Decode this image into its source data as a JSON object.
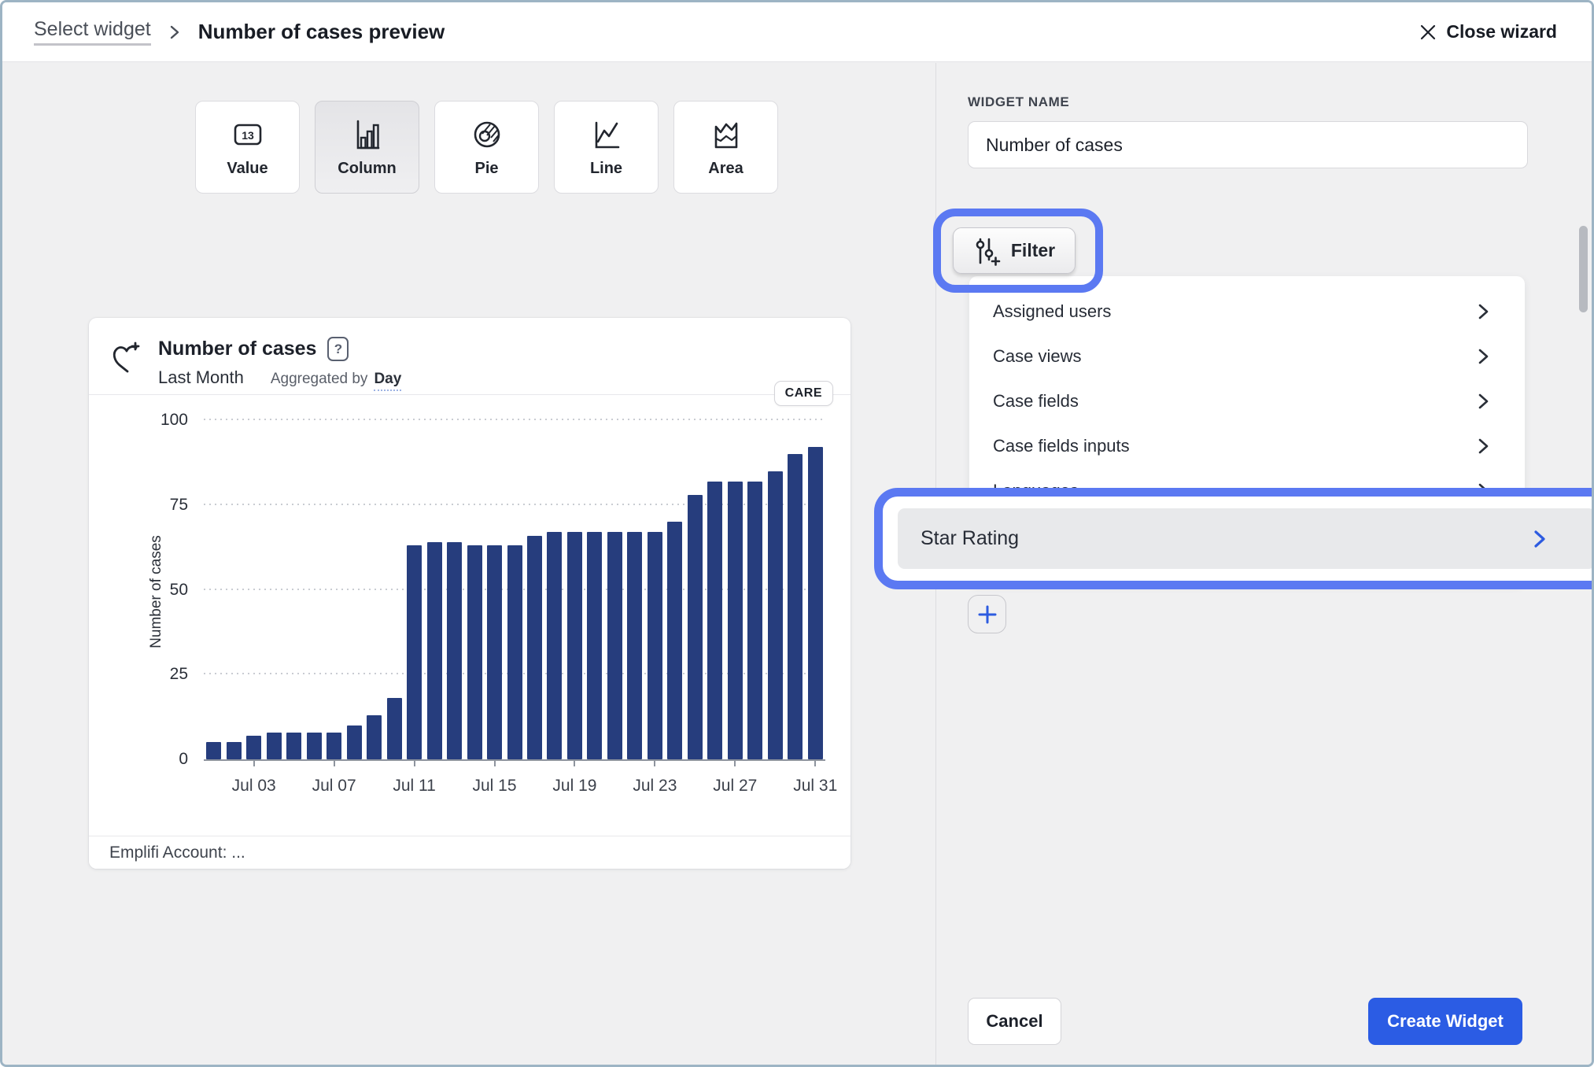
{
  "header": {
    "breadcrumb": "Select widget",
    "title": "Number of cases preview",
    "close_label": "Close wizard"
  },
  "chart_types": [
    {
      "label": "Value",
      "selected": false
    },
    {
      "label": "Column",
      "selected": true
    },
    {
      "label": "Pie",
      "selected": false
    },
    {
      "label": "Line",
      "selected": false
    },
    {
      "label": "Area",
      "selected": false
    }
  ],
  "preview_card": {
    "title": "Number of cases",
    "period": "Last Month",
    "aggregated_prefix": "Aggregated by",
    "aggregated_value": "Day",
    "badge": "CARE",
    "footer": "Emplifi Account: ..."
  },
  "chart_data": {
    "type": "bar",
    "title": "Number of cases",
    "xlabel": "",
    "ylabel": "Number of cases",
    "ylim": [
      0,
      100
    ],
    "yticks": [
      0,
      25,
      50,
      75,
      100
    ],
    "grid": "horizontal-dotted",
    "legend": "none",
    "bar_color": "#263d7d",
    "x": [
      "Jul 01",
      "Jul 02",
      "Jul 03",
      "Jul 04",
      "Jul 05",
      "Jul 06",
      "Jul 07",
      "Jul 08",
      "Jul 09",
      "Jul 10",
      "Jul 11",
      "Jul 12",
      "Jul 13",
      "Jul 14",
      "Jul 15",
      "Jul 16",
      "Jul 17",
      "Jul 18",
      "Jul 19",
      "Jul 20",
      "Jul 21",
      "Jul 22",
      "Jul 23",
      "Jul 24",
      "Jul 25",
      "Jul 26",
      "Jul 27",
      "Jul 28",
      "Jul 29",
      "Jul 30",
      "Jul 31"
    ],
    "values": [
      5,
      5,
      7,
      8,
      8,
      8,
      8,
      10,
      13,
      18,
      63,
      64,
      64,
      63,
      63,
      63,
      66,
      67,
      67,
      67,
      67,
      67,
      67,
      70,
      78,
      82,
      82,
      82,
      85,
      90,
      92
    ],
    "x_tick_labels": [
      "Jul 03",
      "Jul 07",
      "Jul 11",
      "Jul 15",
      "Jul 19",
      "Jul 23",
      "Jul 27",
      "Jul 31"
    ]
  },
  "panel": {
    "widget_name_label": "WIDGET NAME",
    "widget_name_value": "Number of cases",
    "filter_button_label": "Filter",
    "dropdown_items": [
      "Assigned users",
      "Case views",
      "Case fields",
      "Case fields inputs"
    ],
    "partially_hidden_item": "Languages",
    "highlighted_item": "Star Rating",
    "add_button_label": "+",
    "cancel_label": "Cancel",
    "create_label": "Create Widget"
  },
  "colors": {
    "highlight_ring": "#5b79f2",
    "primary_button": "#2b5ce4",
    "chevron_blue": "#2d5be0",
    "bar": "#263d7d",
    "panel_bg": "#f0f0f1"
  }
}
